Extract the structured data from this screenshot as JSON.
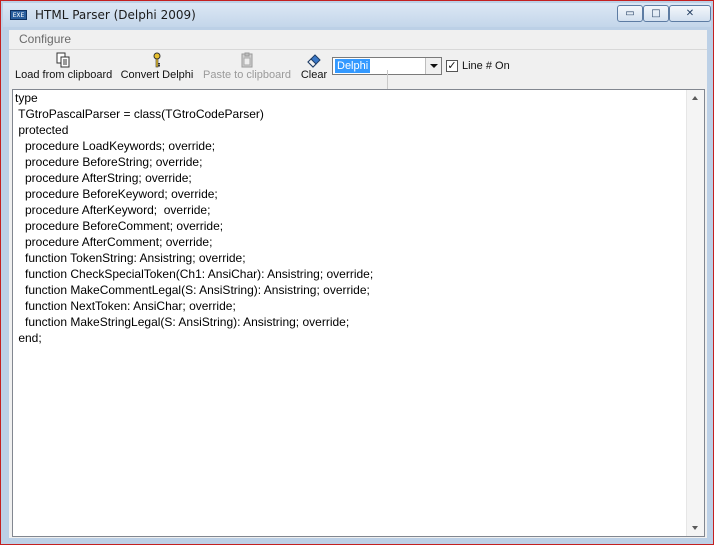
{
  "window": {
    "title": "HTML Parser (Delphi 2009)",
    "icon_text": "EXE",
    "buttons": {
      "minimize": "▭",
      "maximize": "□",
      "close": "✕"
    }
  },
  "menu": {
    "configure": "Configure"
  },
  "toolbar": {
    "load_label": "Load from clipboard",
    "convert_label": "Convert Delphi",
    "paste_label": "Paste to clipboard",
    "clear_label": "Clear",
    "language_value": "Delphi",
    "line_numbers_label": "Line # On",
    "line_numbers_checked": true
  },
  "editor": {
    "lines": [
      "type",
      " TGtroPascalParser = class(TGtroCodeParser)",
      " protected",
      "   procedure LoadKeywords; override;",
      "   procedure BeforeString; override;",
      "   procedure AfterString; override;",
      "   procedure BeforeKeyword; override;",
      "   procedure AfterKeyword;  override;",
      "   procedure BeforeComment; override;",
      "   procedure AfterComment; override;",
      "   function TokenString: Ansistring; override;",
      "   function CheckSpecialToken(Ch1: AnsiChar): Ansistring; override;",
      "   function MakeCommentLegal(S: AnsiString): Ansistring; override;",
      "   function NextToken: AnsiChar; override;",
      "   function MakeStringLegal(S: AnsiString): Ansistring; override;",
      " end;"
    ]
  },
  "colors": {
    "titlebar": "#c4d6ea",
    "selection": "#3399ff",
    "frame_border": "#c42020"
  }
}
